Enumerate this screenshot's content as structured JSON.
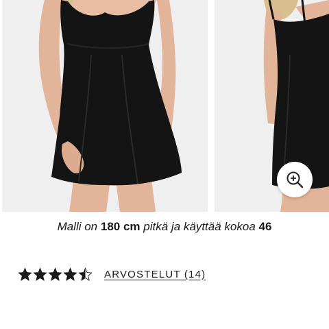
{
  "gallery": {
    "photos": [
      {
        "icon": "product-photo-front"
      },
      {
        "icon": "product-photo-back"
      }
    ],
    "zoom_icon": "zoom-in-icon"
  },
  "model_info": {
    "prefix": "Malli on",
    "height": "180 cm",
    "middle": "pitkä ja käyttää kokoa",
    "size": "46"
  },
  "rating": {
    "value": 4.5,
    "max": 5,
    "star_color": "#1a1a1a",
    "reviews_label": "ARVOSTELUT (14)"
  }
}
